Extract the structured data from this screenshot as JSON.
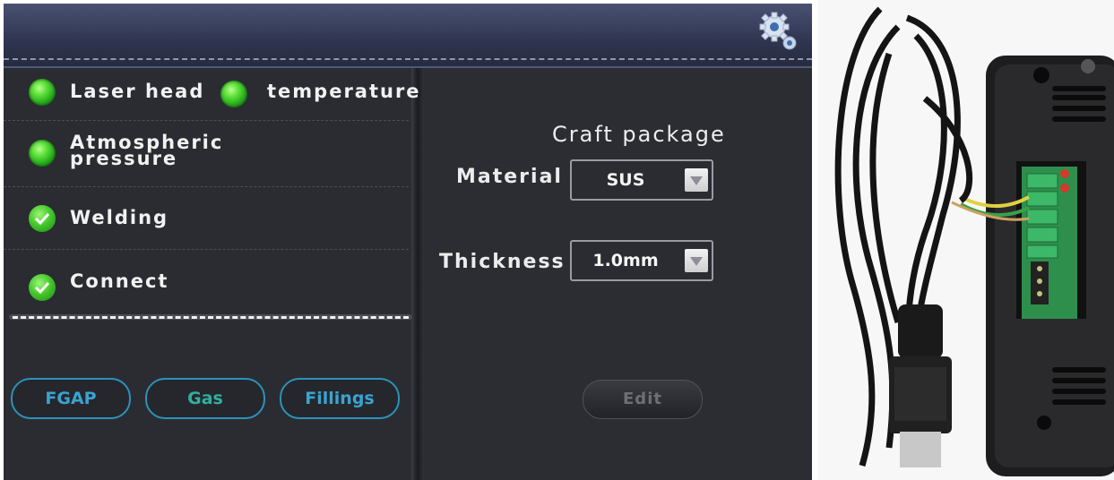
{
  "status": {
    "laser_head": "Laser head",
    "temperature": "temperature",
    "atmospheric_line1": "Atmospheric",
    "atmospheric_line2": "pressure",
    "welding": "Welding",
    "connect": "Connect"
  },
  "buttons": {
    "fgap": "FGAP",
    "gas": "Gas",
    "fillings": "Fillings",
    "edit": "Edit"
  },
  "craft": {
    "title": "Craft package",
    "material_label": "Material",
    "material_value": "SUS",
    "thickness_label": "Thickness",
    "thickness_value": "1.0mm"
  },
  "icons": {
    "settings": "gear-icon",
    "status_ok": "green-led-icon",
    "status_check": "check-circle-icon",
    "dropdown": "dropdown-arrow-icon"
  },
  "colors": {
    "led_green": "#3fcf2a",
    "button_border": "#2a93b8",
    "panel_bg": "#2c2d33",
    "header_bg": "#2f3550"
  }
}
